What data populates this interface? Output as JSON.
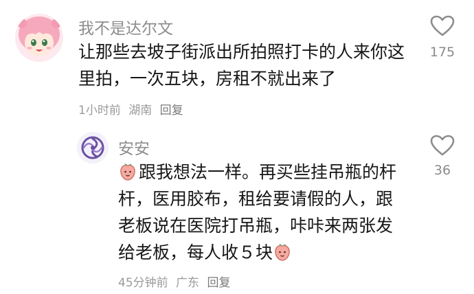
{
  "comment": {
    "username": "我不是达尔文",
    "text_line1": "让那些去坡子街派出所拍照打卡的人来你这",
    "text_line2": "里拍，一次五块，房租不就出来了",
    "time": "1小时前",
    "location": "湖南",
    "reply_label": "回复",
    "like_count": "175",
    "like_icon": "heart-outline-icon"
  },
  "reply": {
    "username": "安安",
    "text_line1": "跟我想法一样。再买些挂吊瓶的杆",
    "text_line2": "杆，医用胶布，租给要请假的人，跟",
    "text_line3": "老板说在医院打吊瓶，咔咔来两张发",
    "text_line4": "给老板，每人收５块",
    "time": "45分钟前",
    "location": "广东",
    "reply_label": "回复",
    "like_count": "36",
    "like_icon": "heart-outline-icon",
    "emoji_icon": "peach-emoji-icon"
  },
  "colors": {
    "text": "#161616",
    "meta": "#9a9a9a",
    "username": "#8d8d8d",
    "avatar_pink": "#f7b6c6"
  }
}
